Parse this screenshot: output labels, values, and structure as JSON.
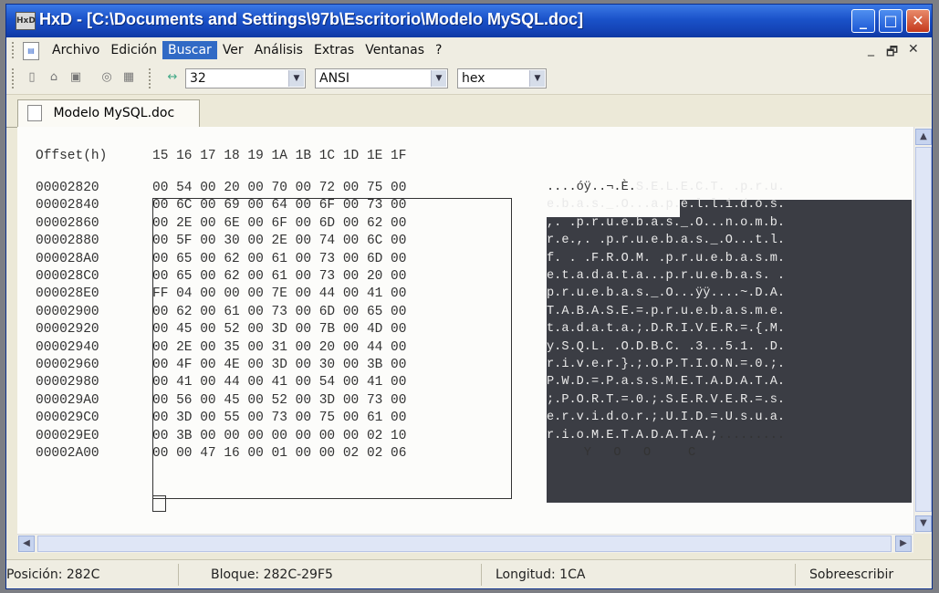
{
  "window": {
    "title": "HxD - [C:\\Documents and Settings\\97b\\Escritorio\\Modelo MySQL.doc]",
    "icon_label": "HxD",
    "controls": {
      "minimize": "_",
      "maximize": "□",
      "close": "✕"
    }
  },
  "menu": {
    "items": [
      "Archivo",
      "Edición",
      "Buscar",
      "Ver",
      "Análisis",
      "Extras",
      "Ventanas",
      "?"
    ],
    "active": "Buscar",
    "mdi_minimize": "_",
    "mdi_restore": "🗗",
    "mdi_close": "✕"
  },
  "toolbar": {
    "bytes_per_row": "32",
    "charset": "ANSI",
    "offset_base": "hex",
    "icons": [
      "new-file-icon",
      "open-file-icon",
      "save-icon",
      "open-disk-icon",
      "open-ram-icon",
      "bytes-per-row-icon"
    ]
  },
  "tab": {
    "label": "Modelo MySQL.doc"
  },
  "editor": {
    "offset_header": "Offset(h)",
    "column_header": "15 16 17 18 19 1A 1B 1C 1D 1E 1F",
    "rows": [
      {
        "offset": "00002820",
        "hex": "00 54 00 20 00 70 00 72 00 75 00",
        "text": "....óÿ..¬.È.S.E.L.E.C.T. .p.r.u."
      },
      {
        "offset": "00002840",
        "hex": "00 6C 00 69 00 64 00 6F 00 73 00",
        "text": "e.b.a.s._.O...a.p.e.l.l.i.d.o.s."
      },
      {
        "offset": "00002860",
        "hex": "00 2E 00 6E 00 6F 00 6D 00 62 00",
        "text": ",. .p.r.u.e.b.a.s._.O...n.o.m.b."
      },
      {
        "offset": "00002880",
        "hex": "00 5F 00 30 00 2E 00 74 00 6C 00",
        "text": "r.e.,. .p.r.u.e.b.a.s._.O...t.l."
      },
      {
        "offset": "000028A0",
        "hex": "00 65 00 62 00 61 00 73 00 6D 00",
        "text": "f. . .F.R.O.M. .p.r.u.e.b.a.s.m."
      },
      {
        "offset": "000028C0",
        "hex": "00 65 00 62 00 61 00 73 00 20 00",
        "text": "e.t.a.d.a.t.a...p.r.u.e.b.a.s. ."
      },
      {
        "offset": "000028E0",
        "hex": "FF 04 00 00 00 7E 00 44 00 41 00",
        "text": "p.r.u.e.b.a.s._.O...ÿÿ....~.D.A."
      },
      {
        "offset": "00002900",
        "hex": "00 62 00 61 00 73 00 6D 00 65 00",
        "text": "T.A.B.A.S.E.=.p.r.u.e.b.a.s.m.e."
      },
      {
        "offset": "00002920",
        "hex": "00 45 00 52 00 3D 00 7B 00 4D 00",
        "text": "t.a.d.a.t.a.;.D.R.I.V.E.R.=.{.M."
      },
      {
        "offset": "00002940",
        "hex": "00 2E 00 35 00 31 00 20 00 44 00",
        "text": "y.S.Q.L. .O.D.B.C. .3...5.1. .D."
      },
      {
        "offset": "00002960",
        "hex": "00 4F 00 4E 00 3D 00 30 00 3B 00",
        "text": "r.i.v.e.r.}.;.O.P.T.I.O.N.=.0.;."
      },
      {
        "offset": "00002980",
        "hex": "00 41 00 44 00 41 00 54 00 41 00",
        "text": "P.W.D.=.P.a.s.s.M.E.T.A.D.A.T.A."
      },
      {
        "offset": "000029A0",
        "hex": "00 56 00 45 00 52 00 3D 00 73 00",
        "text": ";.P.O.R.T.=.0.;.S.E.R.V.E.R.=.s."
      },
      {
        "offset": "000029C0",
        "hex": "00 3D 00 55 00 73 00 75 00 61 00",
        "text": "e.r.v.i.d.o.r.;.U.I.D.=.U.s.u.a."
      },
      {
        "offset": "000029E0",
        "hex": "00 3B 00 00 00 00 00 00 00 02 10",
        "text": "r.i.o.M.E.T.A.D.A.T.A.;........."
      },
      {
        "offset": "00002A00",
        "hex": "00 00 47 16 00 01 00 00 02 02 06",
        "text": "     Y   O   O     C  "
      }
    ]
  },
  "status": {
    "position": "Posición: 282C",
    "block": "Bloque: 282C-29F5",
    "length": "Longitud: 1CA",
    "mode": "Sobreescribir"
  }
}
